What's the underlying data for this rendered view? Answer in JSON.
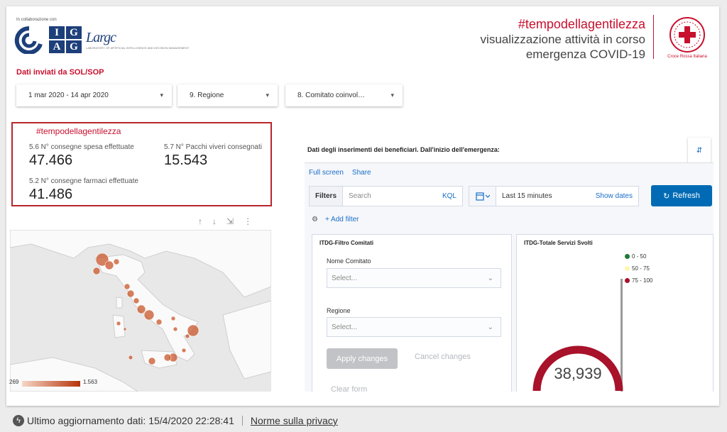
{
  "header": {
    "collab_text": "In collaborazione con",
    "logo_iag_letters": [
      "I",
      "G",
      "A",
      "G"
    ],
    "logo_largc_text": "Largc",
    "logo_largc_sub": "LABORATORY OF ARTIFICIAL INTELLIGENCE AND DECISION MANAGEMENT",
    "hashtag": "#tempodellagentilezza",
    "subtitle_line1": "visualizzazione attività in corso",
    "subtitle_line2": "emergenza COVID-19",
    "org_name": "Croce Rossa Italiana",
    "accent_color": "#c8102e"
  },
  "section_title": "Dati inviati da SOL/SOP",
  "filters": [
    {
      "label": "1 mar 2020 - 14 apr 2020",
      "arrow": "▾"
    },
    {
      "label": "9. Regione",
      "arrow": "▾"
    },
    {
      "label": "8. Comitato coinvol…",
      "arrow": "▾"
    }
  ],
  "kpi": {
    "title": "#tempodellagentilezza",
    "items": [
      {
        "label": "5.6 N° consegne spesa effettuate",
        "value": "47.466"
      },
      {
        "label": "5.7 N° Pacchi viveri consegnati",
        "value": "15.543"
      },
      {
        "label": "5.2 N° consegne farmaci effettuate",
        "value": "41.486"
      }
    ]
  },
  "map": {
    "tools": [
      "↑",
      "↓",
      "⇲",
      "⋮"
    ],
    "legend_min": "269",
    "legend_max": "1.563"
  },
  "kibana": {
    "title": "Dati degli inserimenti dei beneficiari. Dall'inizio dell'emergenza:",
    "edge_icon": "⇵",
    "links": [
      "Full screen",
      "Share"
    ],
    "filters_label": "Filters",
    "search_placeholder": "Search",
    "kql": "KQL",
    "date_range": "Last 15 minutes",
    "show_dates": "Show dates",
    "refresh": "Refresh",
    "add_filter": "+ Add filter",
    "panel_left": {
      "title": "ITDG-Filtro Comitati",
      "field1_label": "Nome Comitato",
      "field1_placeholder": "Select...",
      "field2_label": "Regione",
      "field2_placeholder": "Select...",
      "apply": "Apply changes",
      "cancel": "Cancel changes",
      "clear": "Clear form"
    },
    "panel_right": {
      "title": "ITDG-Totale Servizi Svolti",
      "legend": [
        {
          "label": "0 - 50",
          "color": "#1f7a33"
        },
        {
          "label": "50 - 75",
          "color": "#fff7b0"
        },
        {
          "label": "75 - 100",
          "color": "#a8122a"
        }
      ],
      "gauge_value": "38,939"
    }
  },
  "footer": {
    "last_update": "Ultimo aggiornamento dati: 15/4/2020 22:28:41",
    "privacy": "Norme sulla privacy"
  }
}
